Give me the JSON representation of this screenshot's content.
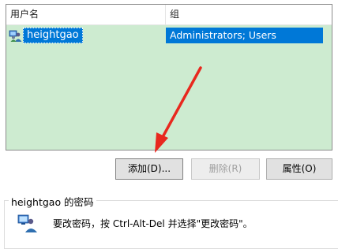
{
  "list": {
    "columns": [
      "用户名",
      "组"
    ],
    "rows": [
      {
        "name": "heightgao",
        "group": "Administrators; Users",
        "icon": "user-group-icon"
      }
    ],
    "background": "#cdebd0",
    "selection_color": "#0078d7"
  },
  "buttons": {
    "add": "添加(D)...",
    "remove": "删除(R)",
    "properties": "属性(O)"
  },
  "password": {
    "title": "heightgao 的密码",
    "text": "要改密码，按 Ctrl-Alt-Del 并选择\"更改密码\"。",
    "icon": "password-user-icon"
  },
  "annotation": {
    "icon": "red-arrow-icon",
    "color": "#e8281e"
  }
}
